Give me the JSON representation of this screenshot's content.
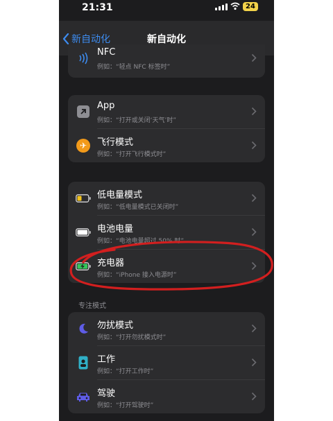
{
  "status": {
    "time": "21:31",
    "battery": "24"
  },
  "nav": {
    "back_label": "新自动化",
    "title": "新自动化"
  },
  "group_top": {
    "nfc": {
      "title": "NFC",
      "subtitle": "例如：“轻点 NFC 标签时”"
    }
  },
  "group_app": {
    "items": [
      {
        "title": "App",
        "subtitle": "例如：“打开或关闭‘天气’时”",
        "icon": "app-arrow-icon"
      },
      {
        "title": "飞行模式",
        "subtitle": "例如：“打开飞行模式时”",
        "icon": "airplane-icon"
      }
    ]
  },
  "group_power": {
    "items": [
      {
        "title": "低电量模式",
        "subtitle": "例如：“低电量模式已关闭时”",
        "icon": "low-battery-icon"
      },
      {
        "title": "电池电量",
        "subtitle": "例如：“电池电量超过 50% 时”",
        "icon": "battery-icon"
      },
      {
        "title": "充电器",
        "subtitle": "例如：“iPhone 接入电源时”",
        "icon": "charger-icon"
      }
    ]
  },
  "focus_section": {
    "header": "专注模式",
    "items": [
      {
        "title": "勿扰模式",
        "subtitle": "例如：“打开勿扰模式时”",
        "icon": "moon-icon"
      },
      {
        "title": "工作",
        "subtitle": "例如：“打开工作时”",
        "icon": "work-badge-icon"
      },
      {
        "title": "驾驶",
        "subtitle": "例如：“打开驾驶时”",
        "icon": "car-icon"
      }
    ]
  },
  "colors": {
    "accent": "#3d8cf0",
    "annotation": "#d21f1f",
    "charger_green": "#34c759"
  }
}
